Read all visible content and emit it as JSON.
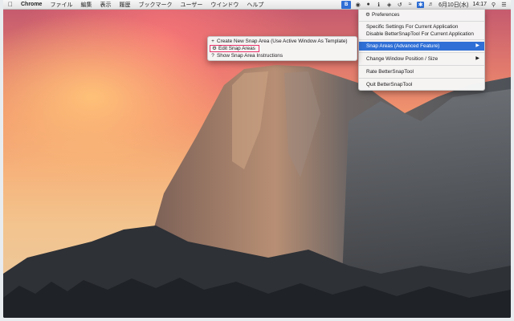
{
  "menubar": {
    "apple_icon": "apple-icon",
    "app_name": "Chrome",
    "items": [
      "ファイル",
      "編集",
      "表示",
      "履歴",
      "ブックマーク",
      "ユーザー",
      "ウインドウ",
      "ヘルプ"
    ],
    "bst_icon_label": "B",
    "status_icons": [
      "bettersnaptool-icon",
      "record-icon",
      "dark-circle-icon",
      "info-icon",
      "shield-icon",
      "time-machine-icon",
      "wifi-icon",
      "bluetooth-icon",
      "volume-icon"
    ],
    "date": "6月10日(水)",
    "time": "14:17",
    "search_icon": "spotlight-icon",
    "list_icon": "notification-list-icon"
  },
  "main_menu": {
    "preferences": "Preferences",
    "specific_settings": "Specific Settings For Current Application",
    "disable_app": "Disable BetterSnapTool For Current Application",
    "snap_areas": "Snap Areas (Advanced Feature)",
    "change_window": "Change Window Position / Size",
    "rate": "Rate BetterSnapTool",
    "quit": "Quit BetterSnapTool"
  },
  "sub_menu": {
    "create_new": "Create New Snap Area (Use Active Window As Template)",
    "edit": "Edit Snap Areas",
    "show_instructions": "Show Snap Area Instructions"
  },
  "colors": {
    "highlight": "#2f6fd6",
    "annotation_box": "#e8336b"
  }
}
